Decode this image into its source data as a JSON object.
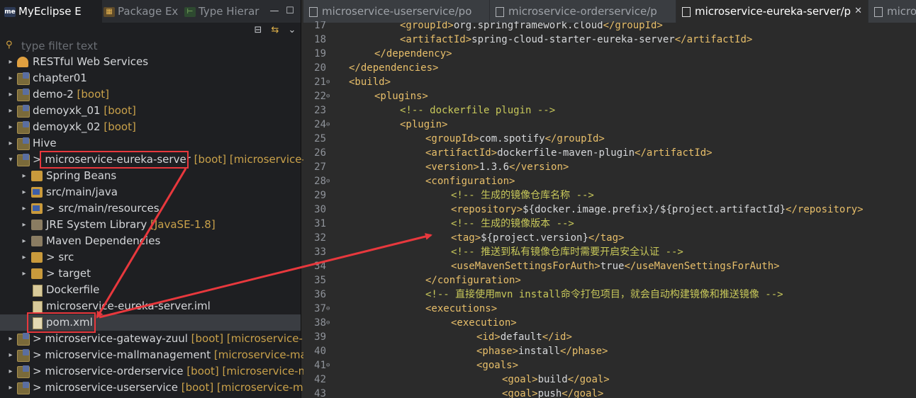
{
  "left_panel": {
    "tabs": [
      {
        "label": "MyEclipse E",
        "icon": "myeclipse-icon",
        "active": true
      },
      {
        "label": "Package Ex",
        "icon": "package-explorer-icon",
        "active": false
      },
      {
        "label": "Type Hierar",
        "icon": "type-hierarchy-icon",
        "active": false
      }
    ],
    "toolbar": {
      "collapse": "⊟",
      "link": "⇆",
      "menu": "⌄"
    },
    "filter_placeholder": "type filter text",
    "tree": [
      {
        "label": "RESTful Web Services",
        "icon": "rest-icon"
      },
      {
        "label": "chapter01",
        "icon": "project-icon"
      },
      {
        "label": "demo-2",
        "decoration": "[boot]",
        "icon": "project-icon"
      },
      {
        "label": "demoyxk_01",
        "decoration": "[boot]",
        "icon": "project-icon"
      },
      {
        "label": "demoyxk_02",
        "decoration": "[boot]",
        "icon": "project-icon"
      },
      {
        "label": "Hive",
        "icon": "project-icon"
      },
      {
        "label": "microservice-eureka-server",
        "prefix": ">",
        "decoration": "[boot] [microservice-",
        "icon": "project-icon"
      },
      {
        "label": "Spring Beans",
        "icon": "spring-beans-icon"
      },
      {
        "label": "src/main/java",
        "icon": "source-folder-icon"
      },
      {
        "label": "src/main/resources",
        "prefix": ">",
        "icon": "source-folder-icon"
      },
      {
        "label": "JRE System Library",
        "decoration": "[JavaSE-1.8]",
        "icon": "library-icon"
      },
      {
        "label": "Maven Dependencies",
        "icon": "library-icon"
      },
      {
        "label": "src",
        "prefix": ">",
        "icon": "folder-icon"
      },
      {
        "label": "target",
        "prefix": ">",
        "icon": "folder-icon"
      },
      {
        "label": "Dockerfile",
        "icon": "file-icon"
      },
      {
        "label": "microservice-eureka-server.iml",
        "icon": "file-icon"
      },
      {
        "label": "pom.xml",
        "icon": "xml-file-icon"
      },
      {
        "label": "microservice-gateway-zuul",
        "prefix": ">",
        "decoration": "[boot] [microservice-r",
        "icon": "project-icon"
      },
      {
        "label": "microservice-mallmanagement",
        "prefix": ">",
        "decoration": "[microservice-mal",
        "icon": "project-icon"
      },
      {
        "label": "microservice-orderservice",
        "prefix": ">",
        "decoration": "[boot] [microservice-m",
        "icon": "project-icon"
      },
      {
        "label": "microservice-userservice",
        "prefix": ">",
        "decoration": "[boot] [microservice-ma",
        "icon": "project-icon"
      }
    ]
  },
  "editor": {
    "tabs": [
      {
        "label": "microservice-userservice/po",
        "active": false
      },
      {
        "label": "microservice-orderservice/p",
        "active": false
      },
      {
        "label": "microservice-eureka-server/p",
        "active": true,
        "close": "✕"
      },
      {
        "label": "micros",
        "active": false
      }
    ],
    "lines": [
      {
        "n": "17",
        "parts": [
          [
            "tag",
            "<groupId>"
          ],
          [
            "text",
            "org.springframework.cloud"
          ],
          [
            "tag",
            "</groupId>"
          ]
        ]
      },
      {
        "n": "18",
        "parts": [
          [
            "tag",
            "<artifactId>"
          ],
          [
            "text",
            "spring-cloud-starter-eureka-server"
          ],
          [
            "tag",
            "</artifactId>"
          ]
        ]
      },
      {
        "n": "19",
        "parts": [
          [
            "tag",
            "</dependency>"
          ]
        ]
      },
      {
        "n": "20",
        "parts": [
          [
            "tag",
            "</dependencies>"
          ]
        ]
      },
      {
        "n": "21",
        "fold": true,
        "parts": [
          [
            "tag",
            "<build>"
          ]
        ]
      },
      {
        "n": "22",
        "fold": true,
        "parts": [
          [
            "tag",
            "<plugins>"
          ]
        ]
      },
      {
        "n": "23",
        "parts": [
          [
            "cmt",
            "<!-- dockerfile plugin -->"
          ]
        ]
      },
      {
        "n": "24",
        "fold": true,
        "parts": [
          [
            "tag",
            "<plugin>"
          ]
        ]
      },
      {
        "n": "25",
        "parts": [
          [
            "tag",
            "<groupId>"
          ],
          [
            "text",
            "com.spotify"
          ],
          [
            "tag",
            "</groupId>"
          ]
        ]
      },
      {
        "n": "26",
        "parts": [
          [
            "tag",
            "<artifactId>"
          ],
          [
            "text",
            "dockerfile-maven-plugin"
          ],
          [
            "tag",
            "</artifactId>"
          ]
        ]
      },
      {
        "n": "27",
        "parts": [
          [
            "tag",
            "<version>"
          ],
          [
            "text",
            "1.3.6"
          ],
          [
            "tag",
            "</version>"
          ]
        ]
      },
      {
        "n": "28",
        "fold": true,
        "parts": [
          [
            "tag",
            "<configuration>"
          ]
        ]
      },
      {
        "n": "29",
        "parts": [
          [
            "cmt",
            "<!-- 生成的镜像仓库名称 -->"
          ]
        ]
      },
      {
        "n": "30",
        "parts": [
          [
            "tag",
            "<repository>"
          ],
          [
            "text",
            "${docker.image.prefix}/${project.artifactId}"
          ],
          [
            "tag",
            "</repository>"
          ]
        ]
      },
      {
        "n": "31",
        "parts": [
          [
            "cmt",
            "<!-- 生成的镜像版本 -->"
          ]
        ]
      },
      {
        "n": "32",
        "parts": [
          [
            "tag",
            "<tag>"
          ],
          [
            "text",
            "${project.version}"
          ],
          [
            "tag",
            "</tag>"
          ]
        ]
      },
      {
        "n": "33",
        "parts": [
          [
            "cmt",
            "<!-- 推送到私有镜像仓库时需要开启安全认证 -->"
          ]
        ]
      },
      {
        "n": "34",
        "parts": [
          [
            "tag",
            "<useMavenSettingsForAuth>"
          ],
          [
            "text",
            "true"
          ],
          [
            "tag",
            "</useMavenSettingsForAuth>"
          ]
        ]
      },
      {
        "n": "35",
        "parts": [
          [
            "tag",
            "</configuration>"
          ]
        ]
      },
      {
        "n": "36",
        "parts": [
          [
            "cmt",
            "<!-- 直接使用mvn install命令打包项目，就会自动构建镜像和推送镜像 -->"
          ]
        ]
      },
      {
        "n": "37",
        "fold": true,
        "parts": [
          [
            "tag",
            "<executions>"
          ]
        ]
      },
      {
        "n": "38",
        "fold": true,
        "parts": [
          [
            "tag",
            "<execution>"
          ]
        ]
      },
      {
        "n": "39",
        "parts": [
          [
            "tag",
            "<id>"
          ],
          [
            "text",
            "default"
          ],
          [
            "tag",
            "</id>"
          ]
        ]
      },
      {
        "n": "40",
        "parts": [
          [
            "tag",
            "<phase>"
          ],
          [
            "text",
            "install"
          ],
          [
            "tag",
            "</phase>"
          ]
        ]
      },
      {
        "n": "41",
        "fold": true,
        "parts": [
          [
            "tag",
            "<goals>"
          ]
        ]
      },
      {
        "n": "42",
        "parts": [
          [
            "tag",
            "<goal>"
          ],
          [
            "text",
            "build"
          ],
          [
            "tag",
            "</goal>"
          ]
        ]
      },
      {
        "n": "43",
        "parts": [
          [
            "tag",
            "<goal>"
          ],
          [
            "text",
            "push"
          ],
          [
            "tag",
            "</goal>"
          ]
        ]
      }
    ]
  },
  "colors": {
    "annotation_red": "#e8383d",
    "tag": "#e8bf6a",
    "comment": "#c8c85a",
    "text": "#d6d8db",
    "decoration": "#c9a14a"
  }
}
